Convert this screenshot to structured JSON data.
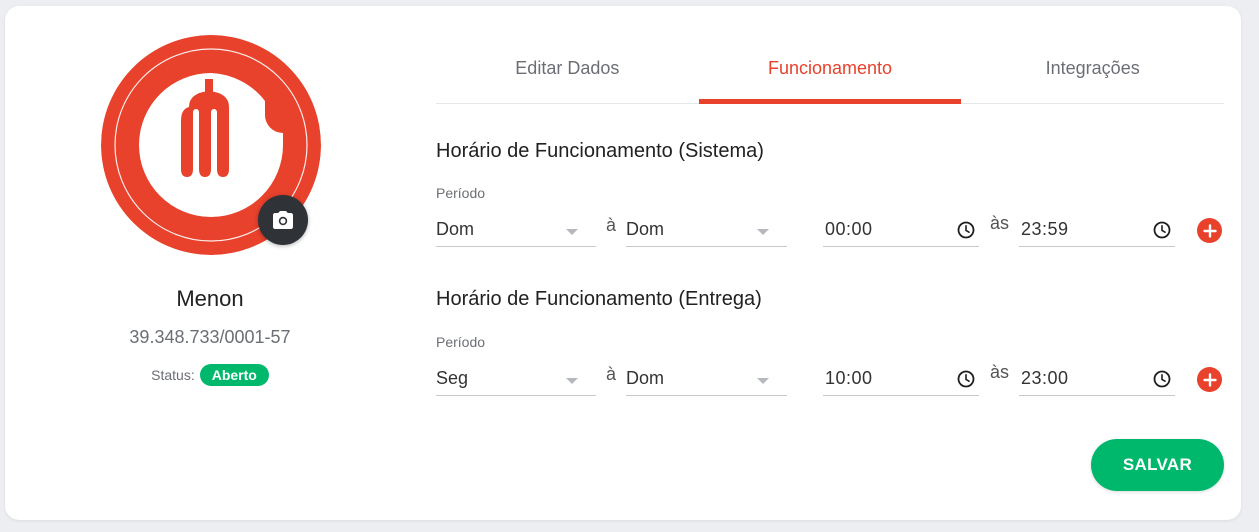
{
  "profile": {
    "name": "Menon",
    "document": "39.348.733/0001-57",
    "status_label": "Status:",
    "status_value": "Aberto"
  },
  "tabs": [
    {
      "label": "Editar Dados",
      "active": false
    },
    {
      "label": "Funcionamento",
      "active": true
    },
    {
      "label": "Integrações",
      "active": false
    }
  ],
  "sections": [
    {
      "title": "Horário de Funcionamento (Sistema)",
      "period_label": "Período",
      "day_from": "Dom",
      "day_joiner": "à",
      "day_to": "Dom",
      "time_from": "00:00",
      "time_joiner": "às",
      "time_to": "23:59"
    },
    {
      "title": "Horário de Funcionamento (Entrega)",
      "period_label": "Período",
      "day_from": "Seg",
      "day_joiner": "à",
      "day_to": "Dom",
      "time_from": "10:00",
      "time_joiner": "às",
      "time_to": "23:00"
    }
  ],
  "actions": {
    "save_label": "SALVAR"
  },
  "colors": {
    "accent": "#e8412c",
    "success": "#00b86b",
    "camera": "#2f3338"
  },
  "icons": [
    "camera-icon",
    "clock-icon",
    "plus-icon",
    "chevron-down-icon",
    "fork-logo"
  ]
}
